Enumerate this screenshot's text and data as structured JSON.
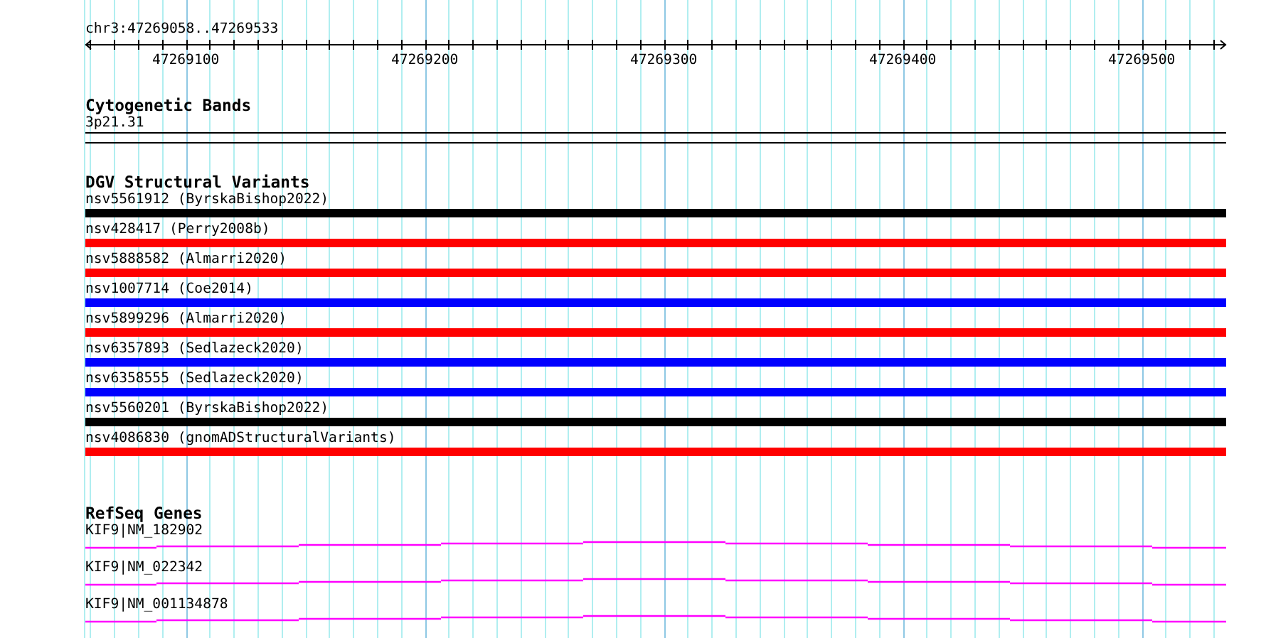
{
  "ruler": {
    "position": "chr3:47269058..47269533",
    "tick_labels": [
      "47269100",
      "47269200",
      "47269300",
      "47269400",
      "47269500"
    ]
  },
  "cytogenetic_bands": {
    "title": "Cytogenetic Bands",
    "bands": [
      {
        "name": "3p21.31"
      }
    ]
  },
  "dgv_structural_variants": {
    "title": "DGV Structural Variants",
    "items": [
      {
        "label": "nsv5561912 (ByrskaBishop2022)",
        "color": "#000000"
      },
      {
        "label": "nsv428417 (Perry2008b)",
        "color": "#ff0000"
      },
      {
        "label": "nsv5888582 (Almarri2020)",
        "color": "#ff0000"
      },
      {
        "label": "nsv1007714 (Coe2014)",
        "color": "#0000ff"
      },
      {
        "label": "nsv5899296 (Almarri2020)",
        "color": "#ff0000"
      },
      {
        "label": "nsv6357893 (Sedlazeck2020)",
        "color": "#0000ff"
      },
      {
        "label": "nsv6358555 (Sedlazeck2020)",
        "color": "#0000ff"
      },
      {
        "label": "nsv5560201 (ByrskaBishop2022)",
        "color": "#000000"
      },
      {
        "label": "nsv4086830 (gnomADStructuralVariants)",
        "color": "#ff0000"
      }
    ]
  },
  "refseq_genes": {
    "title": "RefSeq Genes",
    "genes": [
      {
        "label": "KIF9|NM_182902"
      },
      {
        "label": "KIF9|NM_022342"
      },
      {
        "label": "KIF9|NM_001134878"
      }
    ]
  }
}
